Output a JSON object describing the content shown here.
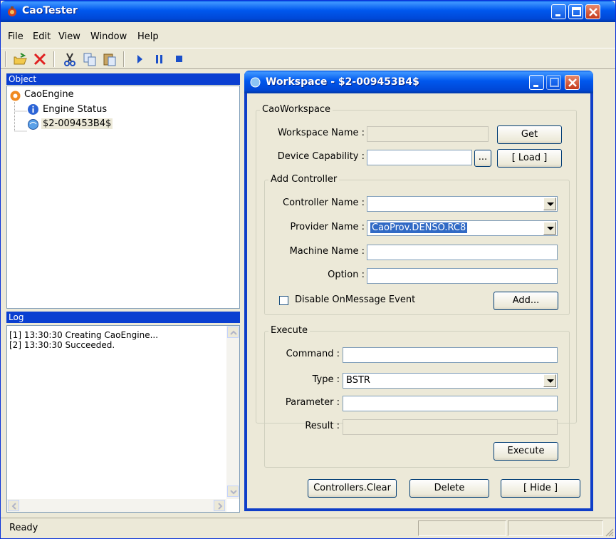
{
  "app": {
    "title": "CaoTester"
  },
  "menu": {
    "file": "File",
    "edit": "Edit",
    "view": "View",
    "window": "Window",
    "help": "Help"
  },
  "object_pane": {
    "header": "Object",
    "tree": [
      {
        "label": "CaoEngine",
        "icon": "gear-icon"
      },
      {
        "label": "Engine Status",
        "icon": "info-icon"
      },
      {
        "label": "$2-009453B4$",
        "icon": "workspace-icon"
      }
    ]
  },
  "log_pane": {
    "header": "Log",
    "lines": [
      "[1] 13:30:30 Creating CaoEngine...",
      "[2] 13:30:30 Succeeded."
    ]
  },
  "workspace": {
    "title": "Workspace - $2-009453B4$",
    "cao_group": "CaoWorkspace",
    "workspace_name_label": "Workspace Name :",
    "workspace_name_value": "",
    "get_button": "Get",
    "device_capability_label": "Device Capability :",
    "device_capability_value": "",
    "browse_button": "...",
    "load_button": "[ Load ]",
    "add_group": "Add Controller",
    "controller_name_label": "Controller Name :",
    "controller_name_value": "",
    "provider_name_label": "Provider Name :",
    "provider_name_value": "CaoProv.DENSO.RC8",
    "machine_name_label": "Machine Name :",
    "machine_name_value": "",
    "option_label": "Option :",
    "option_value": "",
    "disable_event_label": "Disable OnMessage Event",
    "disable_event_checked": false,
    "add_button": "Add...",
    "execute_group": "Execute",
    "command_label": "Command :",
    "command_value": "",
    "type_label": "Type :",
    "type_value": "BSTR",
    "parameter_label": "Parameter :",
    "parameter_value": "",
    "result_label": "Result :",
    "result_value": "",
    "execute_button": "Execute",
    "clear_button": "Controllers.Clear",
    "delete_button": "Delete",
    "hide_button": "[ Hide ]"
  },
  "status": {
    "text": "Ready"
  }
}
